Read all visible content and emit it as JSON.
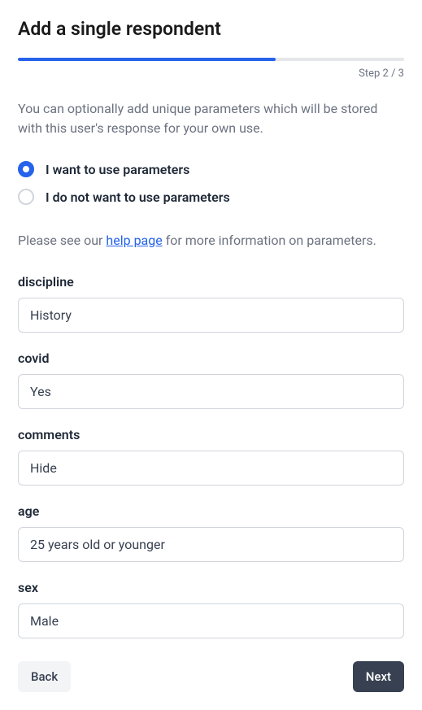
{
  "header": {
    "title": "Add a single respondent"
  },
  "progress": {
    "percent": 66.67,
    "step_text": "Step 2 / 3"
  },
  "description": "You can optionally add unique parameters which will be stored with this user's response for your own use.",
  "radio": {
    "option_use": "I want to use parameters",
    "option_no_use": "I do not want to use parameters",
    "selected": "use"
  },
  "help": {
    "prefix": "Please see our ",
    "link_text": "help page",
    "suffix": " for more information on parameters."
  },
  "fields": {
    "discipline": {
      "label": "discipline",
      "value": "History"
    },
    "covid": {
      "label": "covid",
      "value": "Yes"
    },
    "comments": {
      "label": "comments",
      "value": "Hide"
    },
    "age": {
      "label": "age",
      "value": "25 years old or younger"
    },
    "sex": {
      "label": "sex",
      "value": "Male"
    }
  },
  "buttons": {
    "back": "Back",
    "next": "Next"
  }
}
